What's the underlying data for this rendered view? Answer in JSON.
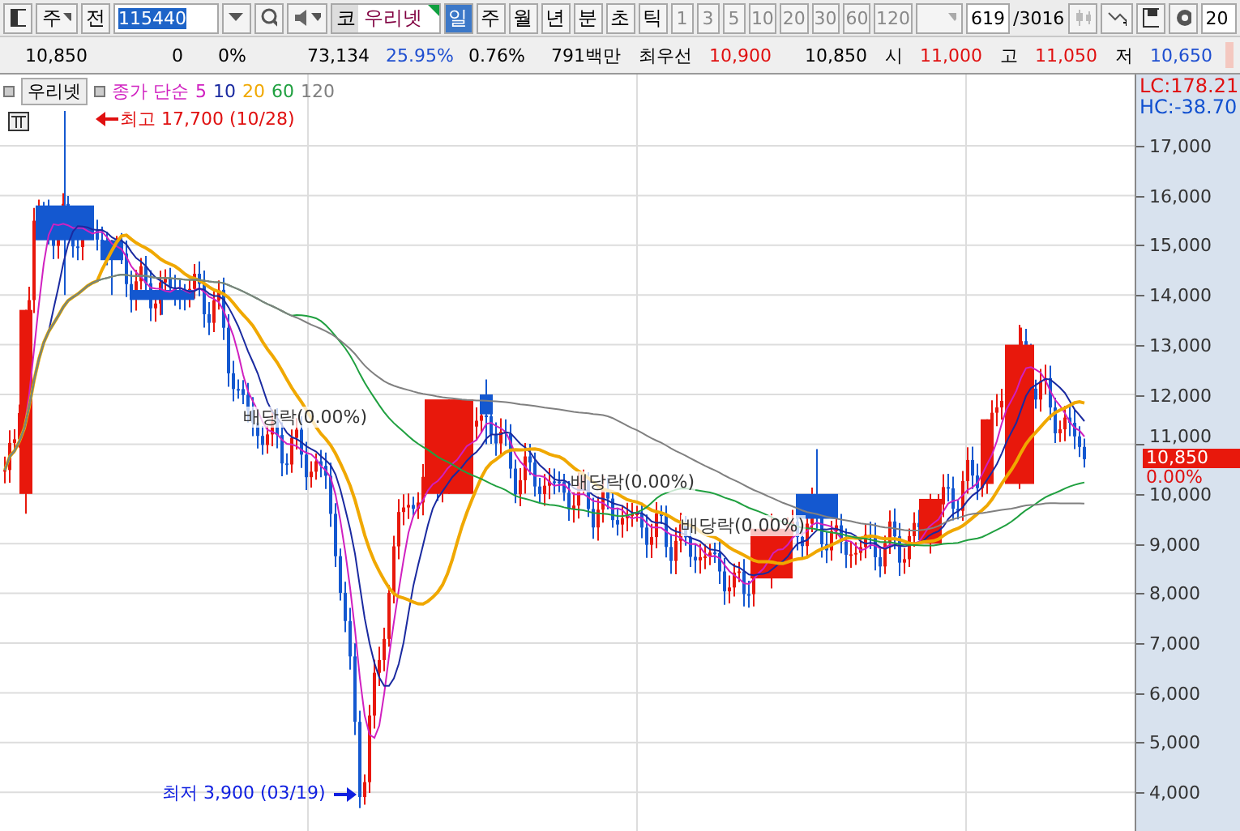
{
  "toolbar": {
    "market": "주",
    "prev_button": "전",
    "code": "115440",
    "market_label": "코",
    "stock_name": "우리넷",
    "period_tabs": [
      {
        "label": "일",
        "selected": true
      },
      {
        "label": "주",
        "selected": false
      },
      {
        "label": "월",
        "selected": false
      },
      {
        "label": "년",
        "selected": false
      },
      {
        "label": "분",
        "selected": false
      },
      {
        "label": "초",
        "selected": false
      },
      {
        "label": "틱",
        "selected": false
      }
    ],
    "intervals": [
      {
        "label": "1",
        "disabled": true
      },
      {
        "label": "3",
        "disabled": true
      },
      {
        "label": "5",
        "disabled": true
      },
      {
        "label": "10",
        "disabled": true
      },
      {
        "label": "20",
        "disabled": true
      },
      {
        "label": "30",
        "disabled": true
      },
      {
        "label": "60",
        "disabled": true
      },
      {
        "label": "120",
        "disabled": true
      }
    ],
    "count": "619",
    "total": "/3016",
    "column_count": "20"
  },
  "quote_bar": [
    {
      "text": "10,850",
      "color": "#000000"
    },
    {
      "text": "0",
      "color": "#000000"
    },
    {
      "text": "0%",
      "color": "#000000"
    },
    {
      "text": "73,134",
      "color": "#000000"
    },
    {
      "text": "25.95%",
      "color": "#1f4fd0"
    },
    {
      "text": "0.76%",
      "color": "#000000"
    },
    {
      "text": "791백만",
      "color": "#000000"
    },
    {
      "text": "최우선",
      "color": "#000000"
    },
    {
      "text": "10,900",
      "color": "#e01010"
    },
    {
      "text": "10,850",
      "color": "#000000"
    },
    {
      "text": "시",
      "color": "#000000"
    },
    {
      "text": "11,000",
      "color": "#e01010"
    },
    {
      "text": "고",
      "color": "#000000"
    },
    {
      "text": "11,050",
      "color": "#e01010"
    },
    {
      "text": "저",
      "color": "#000000"
    },
    {
      "text": "10,650",
      "color": "#1f4fd0"
    }
  ],
  "legend": {
    "name": "우리넷",
    "label": "종가 단순",
    "periods": [
      {
        "text": "5",
        "color": "#d020c0"
      },
      {
        "text": "10",
        "color": "#1a2aa0"
      },
      {
        "text": "20",
        "color": "#f0a800"
      },
      {
        "text": "60",
        "color": "#20a040"
      },
      {
        "text": "120",
        "color": "#808080"
      }
    ]
  },
  "annotations": [
    {
      "kind": "high",
      "text": "최고 17,700 (10/28)"
    },
    {
      "kind": "event",
      "text": "배당락(0.00%)"
    },
    {
      "kind": "event",
      "text": "배당락(0.00%)"
    },
    {
      "kind": "event",
      "text": "배당락(0.00%)"
    },
    {
      "kind": "low",
      "text": "최저 3,900 (03/19)"
    }
  ],
  "axis": {
    "lc": "LC:178.21",
    "hc": "HC:-38.70",
    "ticks": [
      "17,000",
      "16,000",
      "15,000",
      "14,000",
      "13,000",
      "12,000",
      "11,000",
      "10,000",
      "9,000",
      "8,000",
      "7,000",
      "6,000",
      "5,000",
      "4,000"
    ],
    "price": "10,850",
    "change": "0.00%"
  }
}
